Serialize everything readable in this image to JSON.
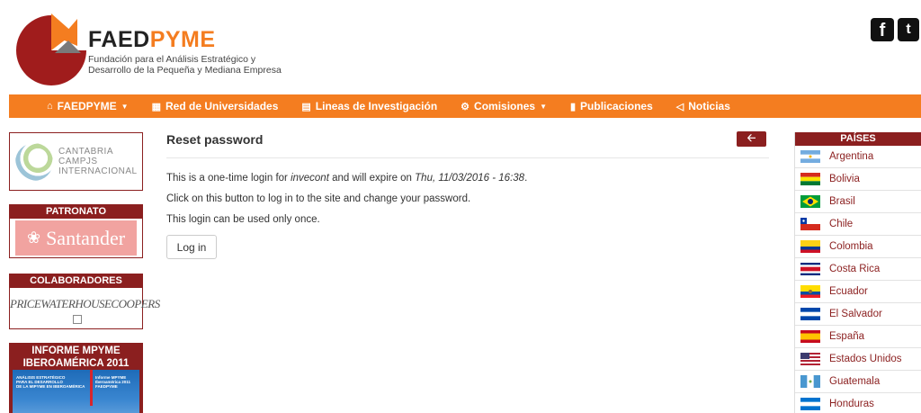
{
  "brand": {
    "name_part1": "FAED",
    "name_part2": "PYME",
    "subtitle_line1": "Fundación para el Análisis Estratégico y",
    "subtitle_line2": "Desarrollo de la Pequeña y Mediana Empresa",
    "logo_icon": "faedpyme-logo-icon",
    "colors": {
      "orange": "#f47d20",
      "dark_red": "#a01c1c"
    }
  },
  "social": {
    "facebook": "f",
    "twitter": "t"
  },
  "nav": {
    "items": [
      {
        "label": "FAEDPYME",
        "icon": "home-icon",
        "dropdown": true
      },
      {
        "label": "Red de Universidades",
        "icon": "university-icon",
        "dropdown": false
      },
      {
        "label": "Lineas de Investigación",
        "icon": "chart-icon",
        "dropdown": false
      },
      {
        "label": "Comisiones",
        "icon": "gear-icon",
        "dropdown": true
      },
      {
        "label": "Publicaciones",
        "icon": "book-icon",
        "dropdown": false
      },
      {
        "label": "Noticias",
        "icon": "megaphone-icon",
        "dropdown": false
      }
    ]
  },
  "left_sidebar": {
    "cantabria": {
      "line1": "CANTABRIA",
      "line2": "CAMPJS",
      "line3": "INTERNACIONAL"
    },
    "patronato": {
      "title": "PATRONATO",
      "sponsor": "Santander"
    },
    "colaboradores": {
      "title": "COLABORADORES",
      "sponsor": "PRICEWATERHOUSECOOPERS"
    },
    "informe": {
      "title_line1": "INFORME MPYME",
      "title_line2": "IBEROAMÉRICA 2011",
      "cover_left_1": "ANÁLISIS ESTRATÉGICO",
      "cover_left_2": "PARA EL DESARROLLO",
      "cover_left_3": "DE LA MIPYME EN IBEROAMÉRICA",
      "cover_right_1": "Informe MPYME",
      "cover_right_2": "Iberoamérica 2011",
      "cover_right_3": "FAEDPYME"
    }
  },
  "main": {
    "title": "Reset password",
    "line1_pre": "This is a one-time login for ",
    "line1_user": "invecont",
    "line1_mid": " and will expire on ",
    "line1_date": "Thu, 11/03/2016 - 16:38",
    "line1_post": ".",
    "line2": "Click on this button to log in to the site and change your password.",
    "line3": "This login can be used only once.",
    "login_label": "Log in",
    "back_icon": "arrow-left-icon"
  },
  "paises": {
    "title": "PAÍSES",
    "items": [
      {
        "name": "Argentina",
        "flag": "argentina"
      },
      {
        "name": "Bolivia",
        "flag": "bolivia"
      },
      {
        "name": "Brasil",
        "flag": "brasil"
      },
      {
        "name": "Chile",
        "flag": "chile"
      },
      {
        "name": "Colombia",
        "flag": "colombia"
      },
      {
        "name": "Costa Rica",
        "flag": "costa-rica"
      },
      {
        "name": "Ecuador",
        "flag": "ecuador"
      },
      {
        "name": "El Salvador",
        "flag": "el-salvador"
      },
      {
        "name": "España",
        "flag": "espana"
      },
      {
        "name": "Estados Unidos",
        "flag": "estados-unidos"
      },
      {
        "name": "Guatemala",
        "flag": "guatemala"
      },
      {
        "name": "Honduras",
        "flag": "honduras"
      }
    ]
  }
}
